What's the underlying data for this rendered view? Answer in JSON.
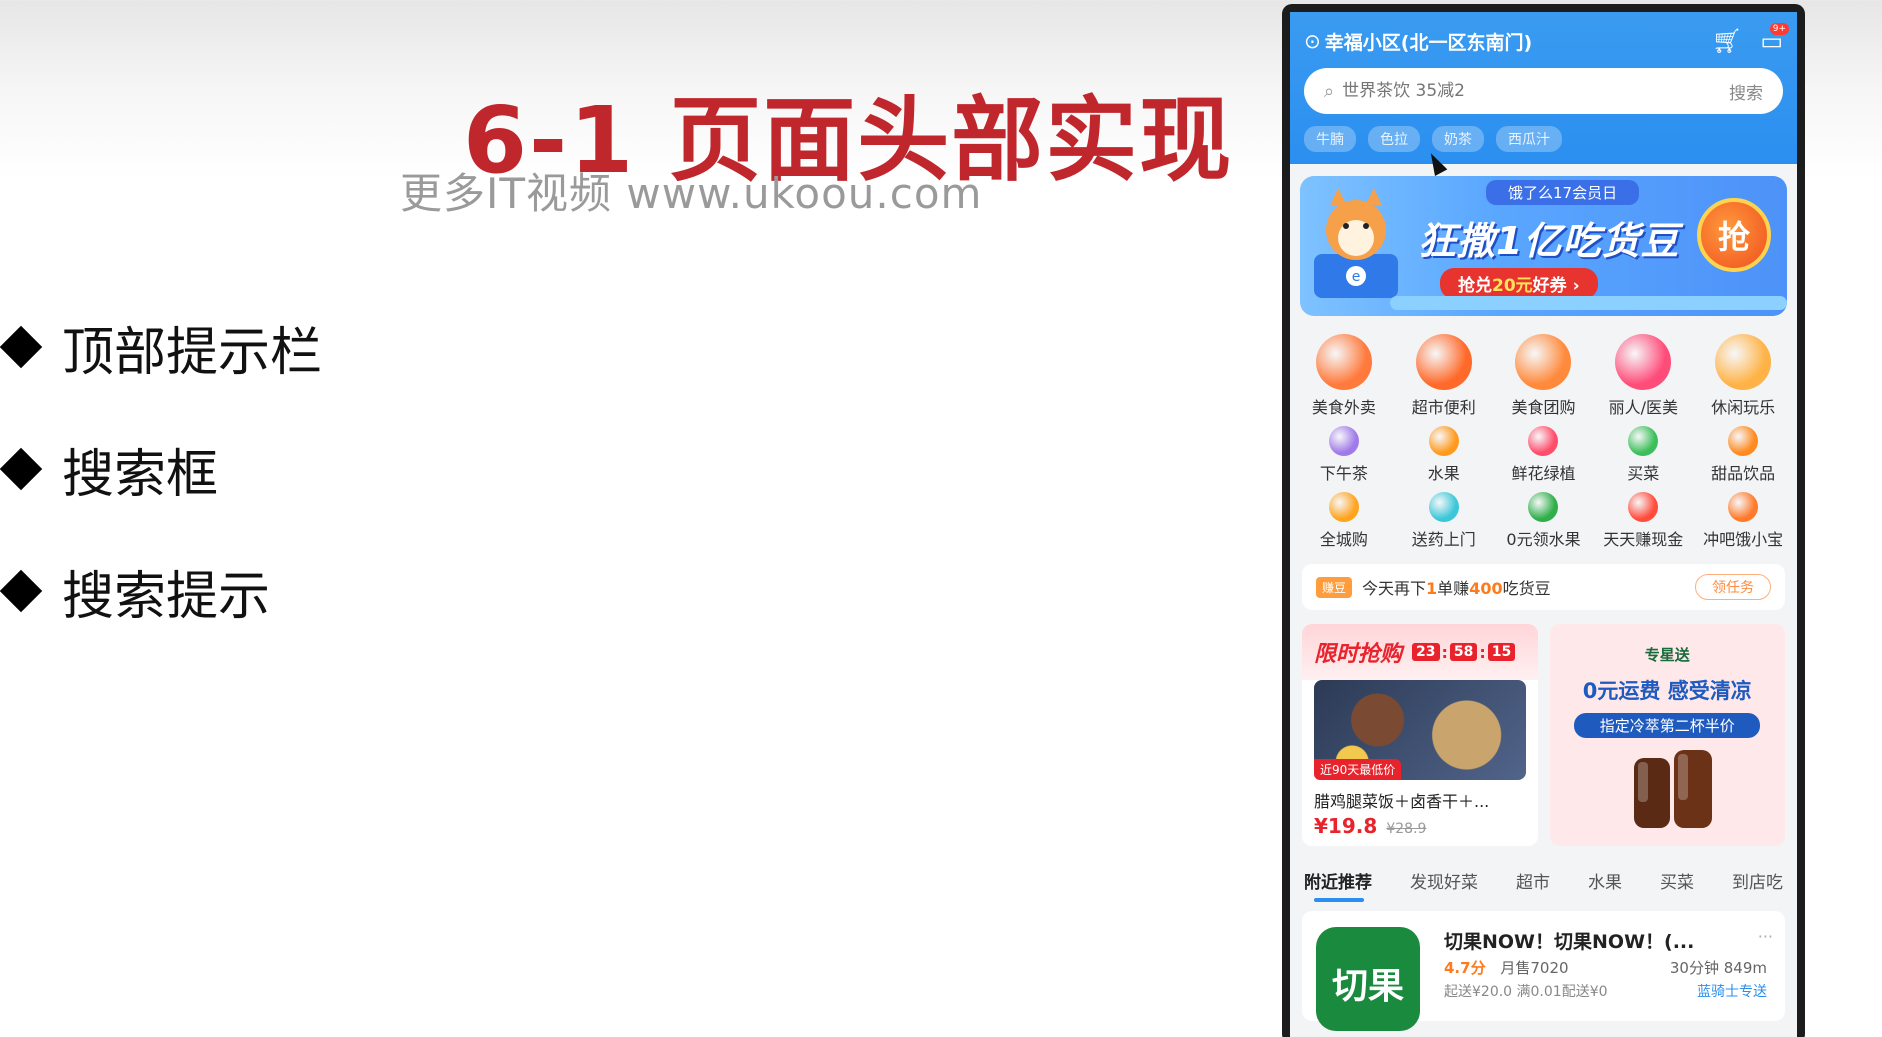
{
  "slide": {
    "title": "6-1 页面头部实现",
    "watermark": "更多IT视频 www.ukoou.com",
    "bullets": [
      {
        "label": "顶部提示栏"
      },
      {
        "label": "搜索框"
      },
      {
        "label": "搜索提示"
      }
    ]
  },
  "phone": {
    "location": "幸福小区(北一区东南门)",
    "message_badge": "9+",
    "search": {
      "placeholder": "世界茶饮 35减2",
      "button": "搜索"
    },
    "hint_tags": [
      "牛腩",
      "色拉",
      "奶茶",
      "西瓜汁"
    ],
    "banner": {
      "pill": "饿了么17会员日",
      "headline": "狂撒1亿吃货豆",
      "coupon_prefix": "抢兑",
      "coupon_amount": "20元",
      "coupon_suffix": "好券",
      "grab": "抢"
    },
    "categories": [
      {
        "label": "美食外卖",
        "color": "#ff7a3c",
        "size": "big"
      },
      {
        "label": "超市便利",
        "color": "#ff6a2a",
        "size": "big"
      },
      {
        "label": "美食团购",
        "color": "#ff8a3c",
        "size": "big"
      },
      {
        "label": "丽人/医美",
        "color": "#ff4d7a",
        "size": "big"
      },
      {
        "label": "休闲玩乐",
        "color": "#ffb347",
        "size": "big"
      },
      {
        "label": "下午茶",
        "color": "#a07ae8",
        "size": "small"
      },
      {
        "label": "水果",
        "color": "#ff9a1f",
        "size": "small"
      },
      {
        "label": "鲜花绿植",
        "color": "#ff4d6a",
        "size": "small"
      },
      {
        "label": "买菜",
        "color": "#3cbf5a",
        "size": "small"
      },
      {
        "label": "甜品饮品",
        "color": "#ff8a1f",
        "size": "small"
      },
      {
        "label": "全城购",
        "color": "#ffa41f",
        "size": "small"
      },
      {
        "label": "送药上门",
        "color": "#3cc7d8",
        "size": "small"
      },
      {
        "label": "0元领水果",
        "color": "#2fae4a",
        "size": "small"
      },
      {
        "label": "天天赚现金",
        "color": "#ff4d3c",
        "size": "small"
      },
      {
        "label": "冲吧饿小宝",
        "color": "#ff7a2a",
        "size": "small"
      }
    ],
    "task": {
      "tag": "赚豆",
      "text_a": "今天再下",
      "count": "1",
      "text_b": "单赚",
      "beans": "400",
      "text_c": "吃货豆",
      "button": "领任务"
    },
    "flash": {
      "title": "限时抢购",
      "hh": "23",
      "mm": "58",
      "ss": "15",
      "lowest": "近90天最低价",
      "name": "腊鸡腿菜饭＋卤香干＋...",
      "price": "¥19.8",
      "old_price": "¥28.9"
    },
    "starbucks": {
      "brand": "专星送",
      "title": "0元运费 感受清凉",
      "sub": "指定冷萃第二杯半价"
    },
    "tabs": [
      "附近推荐",
      "发现好菜",
      "超市",
      "水果",
      "买菜",
      "到店吃"
    ],
    "shop": {
      "logo": "切果",
      "name": "切果NOW！切果NOW！(...",
      "more": "···",
      "score": "4.7分",
      "sold": "月售7020",
      "eta": "30分钟 849m",
      "fee": "起送¥20.0 满0.01配送¥0",
      "rider": "蓝骑士专送"
    }
  }
}
